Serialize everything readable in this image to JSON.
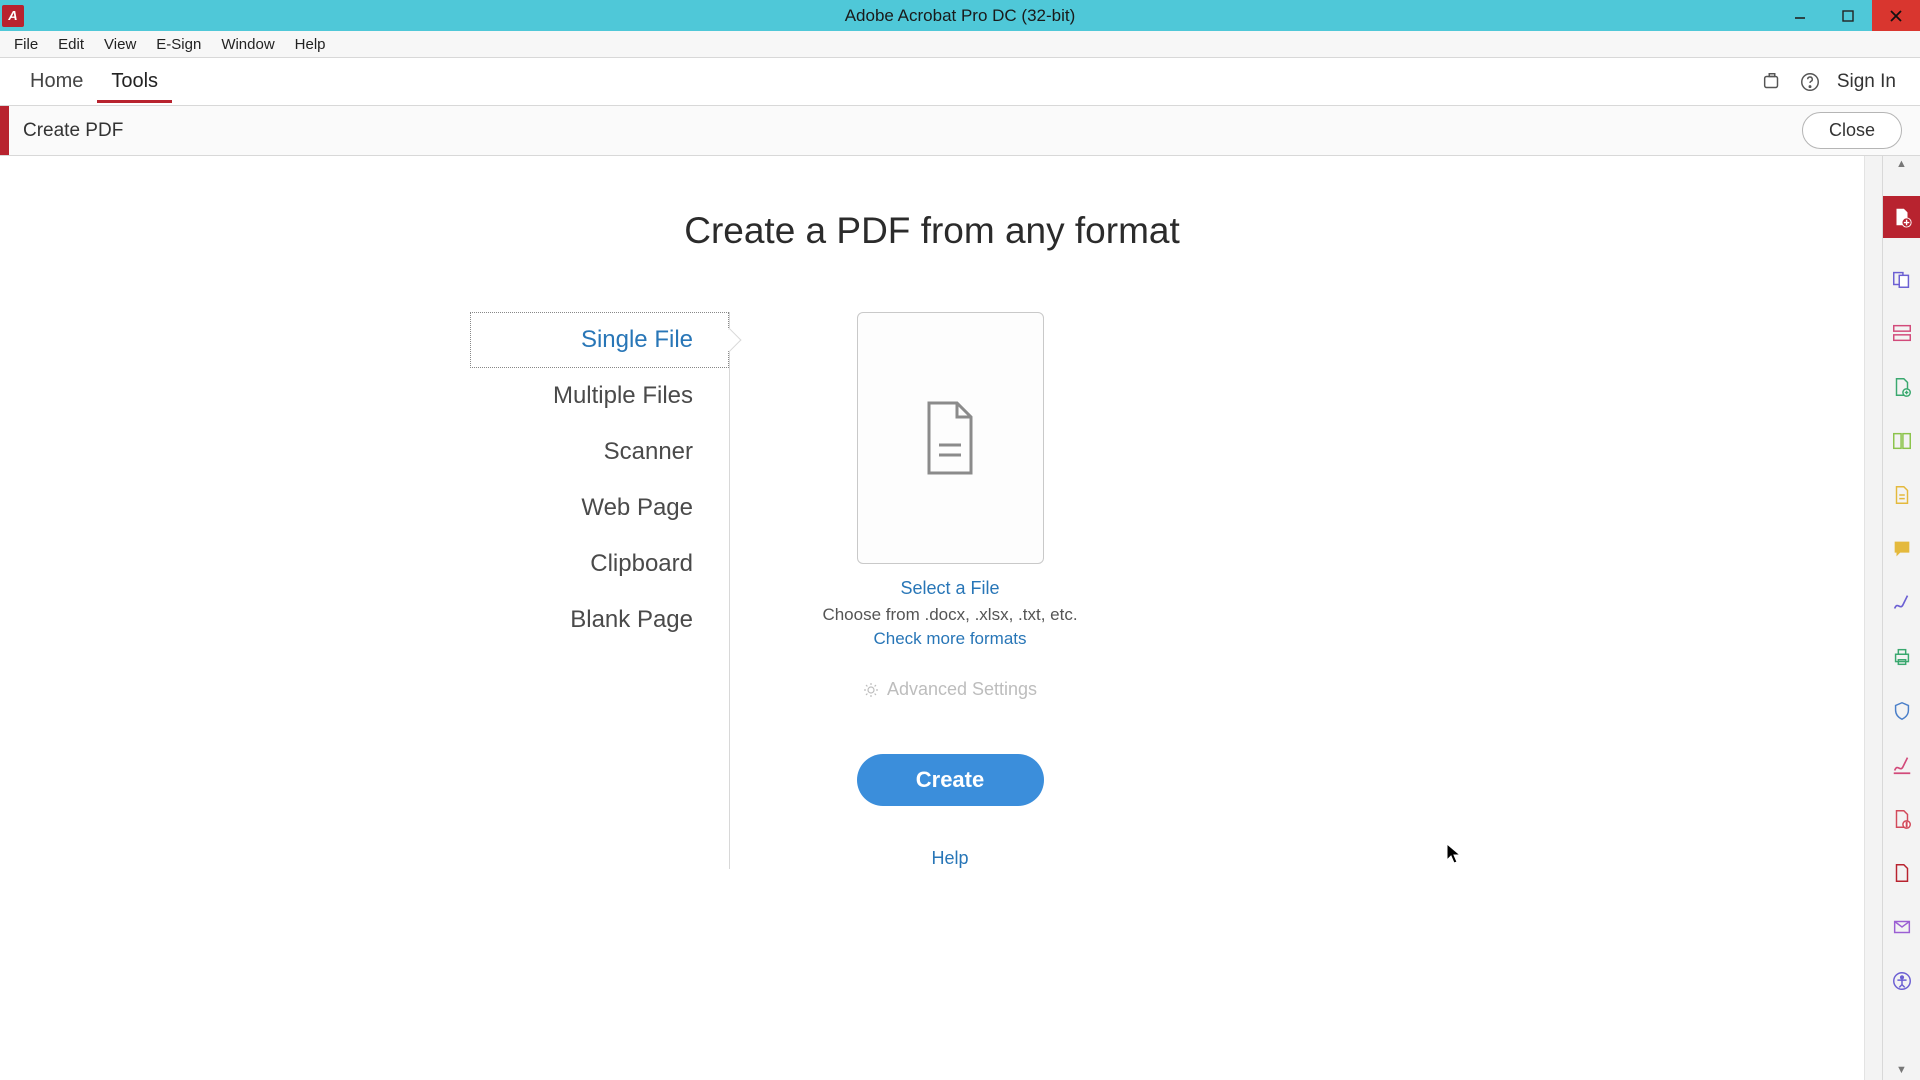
{
  "titlebar": {
    "title": "Adobe Acrobat Pro DC (32-bit)"
  },
  "menubar": {
    "items": [
      "File",
      "Edit",
      "View",
      "E-Sign",
      "Window",
      "Help"
    ]
  },
  "tabrow": {
    "home": "Home",
    "tools": "Tools",
    "signin": "Sign In"
  },
  "tool_header": {
    "title": "Create PDF",
    "close": "Close"
  },
  "content": {
    "heading": "Create a PDF from any format",
    "sources": [
      "Single File",
      "Multiple Files",
      "Scanner",
      "Web Page",
      "Clipboard",
      "Blank Page"
    ],
    "select_file": "Select a File",
    "choose_hint": "Choose from .docx, .xlsx, .txt, etc.",
    "check_formats": "Check more formats",
    "advanced": "Advanced Settings",
    "create": "Create",
    "help": "Help"
  }
}
